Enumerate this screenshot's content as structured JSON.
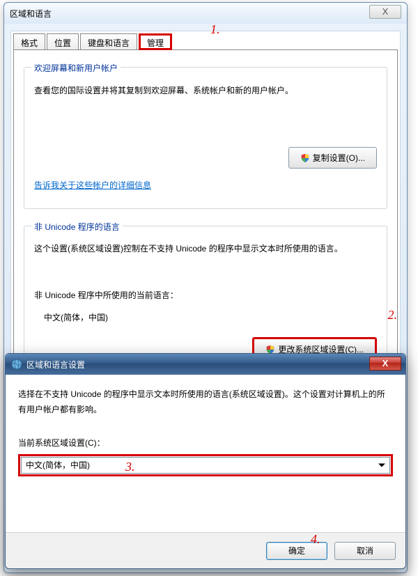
{
  "main_window": {
    "title": "区域和语言",
    "close_glyph": "X",
    "tabs": {
      "format": "格式",
      "location": "位置",
      "keyboard": "键盘和语言",
      "admin": "管理"
    },
    "group1": {
      "title": "欢迎屏幕和新用户帐户",
      "desc": "查看您的国际设置并将其复制到欢迎屏幕、系统帐户和新的用户帐户。",
      "copy_button": "复制设置(O)...",
      "link": "告诉我关于这些帐户的详细信息"
    },
    "group2": {
      "title": "非 Unicode 程序的语言",
      "desc": "这个设置(系统区域设置)控制在不支持 Unicode 的程序中显示文本时所使用的语言。",
      "current_label": "非 Unicode 程序中所使用的当前语言：",
      "current_value": "中文(简体，中国)",
      "change_button": "更改系统区域设置(C)..."
    }
  },
  "dialog": {
    "title": "区域和语言设置",
    "close_glyph": "X",
    "desc": "选择在不支持 Unicode 的程序中显示文本时所使用的语言(系统区域设置)。这个设置对计算机上的所有用户帐户都有影响。",
    "label": "当前系统区域设置(C)：",
    "select_value": "中文(简体，中国)",
    "ok": "确定",
    "cancel": "取消"
  },
  "annotations": {
    "a1": "1.",
    "a2": "2.",
    "a3": "3.",
    "a4": "4."
  }
}
